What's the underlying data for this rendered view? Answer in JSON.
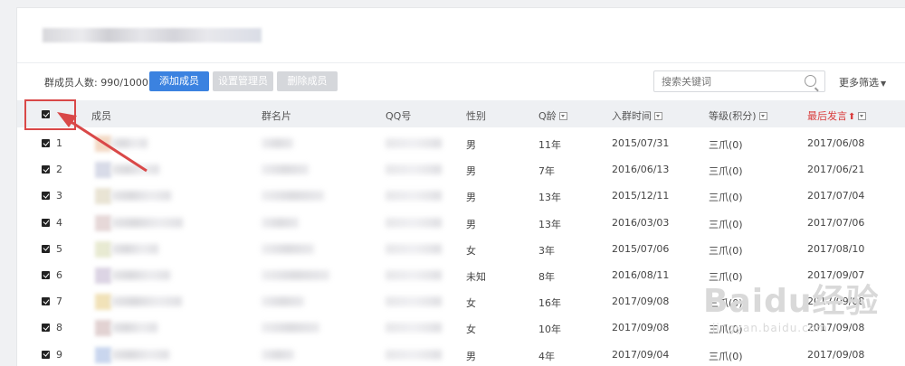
{
  "toolbar": {
    "member_count_label": "群成员人数: 990/1000",
    "add_member": "添加成员",
    "set_admin": "设置管理员",
    "delete_member": "删除成员",
    "search_placeholder": "搜索关键词",
    "more_filters": "更多筛选"
  },
  "table": {
    "headers": {
      "member": "成员",
      "group_card": "群名片",
      "qq": "QQ号",
      "gender": "性别",
      "q_age": "Q龄",
      "join_time": "入群时间",
      "level": "等级(积分)",
      "last_speak": "最后发言"
    },
    "rows": [
      {
        "index": "1",
        "gender": "男",
        "q_age": "11年",
        "join_time": "2015/07/31",
        "level": "三爪(0)",
        "last_speak": "2017/06/08"
      },
      {
        "index": "2",
        "gender": "男",
        "q_age": "7年",
        "join_time": "2016/06/13",
        "level": "三爪(0)",
        "last_speak": "2017/06/21"
      },
      {
        "index": "3",
        "gender": "男",
        "q_age": "13年",
        "join_time": "2015/12/11",
        "level": "三爪(0)",
        "last_speak": "2017/07/04"
      },
      {
        "index": "4",
        "gender": "男",
        "q_age": "13年",
        "join_time": "2016/03/03",
        "level": "三爪(0)",
        "last_speak": "2017/07/06"
      },
      {
        "index": "5",
        "gender": "女",
        "q_age": "3年",
        "join_time": "2015/07/06",
        "level": "三爪(0)",
        "last_speak": "2017/08/10"
      },
      {
        "index": "6",
        "gender": "未知",
        "q_age": "8年",
        "join_time": "2016/08/11",
        "level": "三爪(0)",
        "last_speak": "2017/09/07"
      },
      {
        "index": "7",
        "gender": "女",
        "q_age": "16年",
        "join_time": "2017/09/08",
        "level": "三爪(0)",
        "last_speak": "2017/09/08"
      },
      {
        "index": "8",
        "gender": "女",
        "q_age": "10年",
        "join_time": "2017/09/08",
        "level": "三爪(0)",
        "last_speak": "2017/09/08"
      },
      {
        "index": "9",
        "gender": "男",
        "q_age": "4年",
        "join_time": "2017/09/04",
        "level": "三爪(0)",
        "last_speak": "2017/09/08"
      }
    ]
  },
  "watermark": {
    "brand": "Baidu经验",
    "url": "jingyan.baidu.com"
  },
  "colors": {
    "primary": "#3b82e0",
    "highlight": "#d94848",
    "sorted_header": "#d93b3b"
  }
}
